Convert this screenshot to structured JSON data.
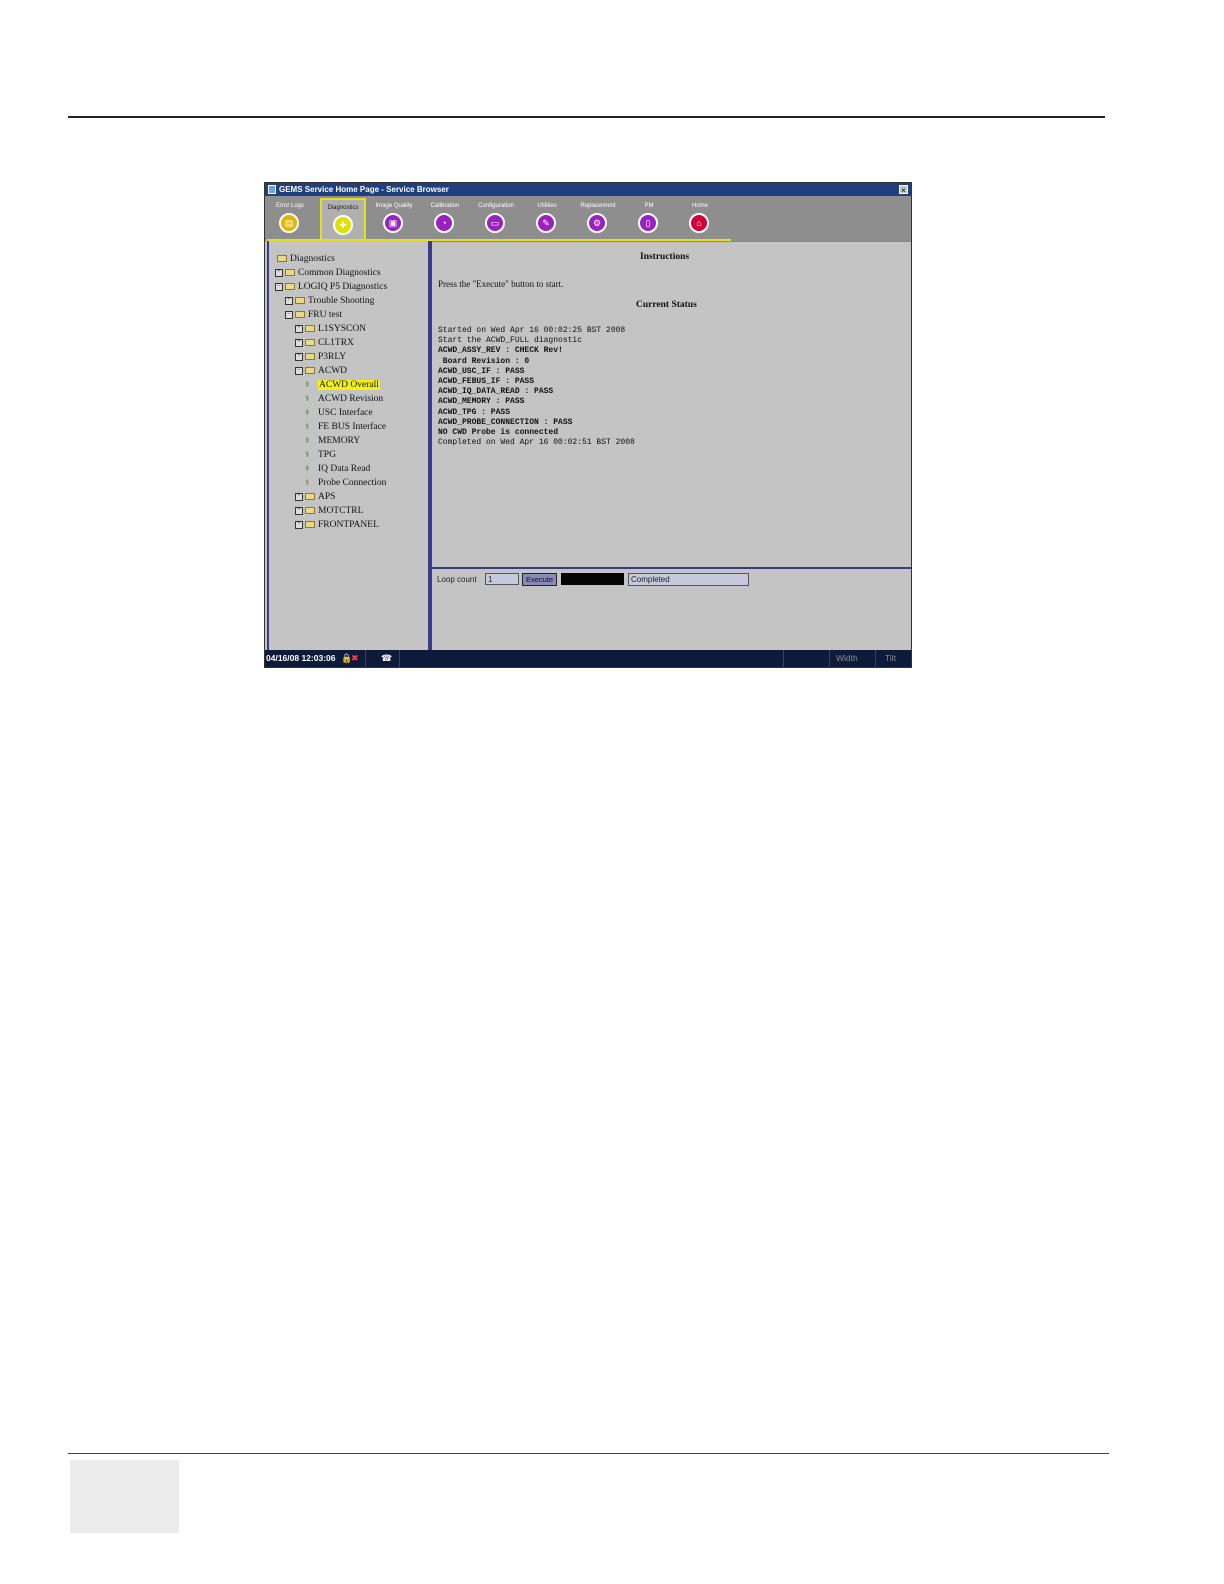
{
  "window": {
    "title": "GEMS Service Home Page - Service Browser",
    "close_glyph": "×"
  },
  "tabs": [
    {
      "label": "Error Logs",
      "icon": "list-icon",
      "color": "#e6b400",
      "glyph": "▤"
    },
    {
      "label": "Diagnostics",
      "icon": "stethoscope-icon",
      "color": "#e2e000",
      "glyph": "✚"
    },
    {
      "label": "Image Quality",
      "icon": "image-icon",
      "color": "#9a20c0",
      "glyph": "▣"
    },
    {
      "label": "Calibration",
      "icon": "gauge-icon",
      "color": "#9a20c0",
      "glyph": "◔"
    },
    {
      "label": "Configuration",
      "icon": "config-icon",
      "color": "#9a20c0",
      "glyph": "▭"
    },
    {
      "label": "Utilities",
      "icon": "tools-icon",
      "color": "#9a20c0",
      "glyph": "✎"
    },
    {
      "label": "Replacement",
      "icon": "wrench-icon",
      "color": "#9a20c0",
      "glyph": "⚙"
    },
    {
      "label": "PM",
      "icon": "clipboard-icon",
      "color": "#9a20c0",
      "glyph": "▯"
    },
    {
      "label": "Home",
      "icon": "home-icon",
      "color": "#d0003a",
      "glyph": "⌂"
    }
  ],
  "tree": [
    {
      "label": "Diagnostics",
      "indent": 0,
      "type": "folder-open",
      "toggle": ""
    },
    {
      "label": "Common Diagnostics",
      "indent": 0,
      "type": "folder",
      "toggle": "+"
    },
    {
      "label": "LOGIQ P5 Diagnostics",
      "indent": 0,
      "type": "folder-open",
      "toggle": "−"
    },
    {
      "label": "Trouble Shooting",
      "indent": 1,
      "type": "folder",
      "toggle": "+"
    },
    {
      "label": "FRU test",
      "indent": 1,
      "type": "folder-open",
      "toggle": "−"
    },
    {
      "label": "L1SYSCON",
      "indent": 2,
      "type": "folder",
      "toggle": "+"
    },
    {
      "label": "CL1TRX",
      "indent": 2,
      "type": "folder",
      "toggle": "+"
    },
    {
      "label": "P3RLY",
      "indent": 2,
      "type": "folder",
      "toggle": "+"
    },
    {
      "label": "ACWD",
      "indent": 2,
      "type": "folder-open",
      "toggle": "−"
    },
    {
      "label": "ACWD Overall",
      "indent": 3,
      "type": "leaf",
      "toggle": "",
      "selected": true
    },
    {
      "label": "ACWD Revision",
      "indent": 3,
      "type": "leaf",
      "toggle": ""
    },
    {
      "label": "USC Interface",
      "indent": 3,
      "type": "leaf",
      "toggle": ""
    },
    {
      "label": "FE BUS Interface",
      "indent": 3,
      "type": "leaf",
      "toggle": ""
    },
    {
      "label": "MEMORY",
      "indent": 3,
      "type": "leaf",
      "toggle": ""
    },
    {
      "label": "TPG",
      "indent": 3,
      "type": "leaf",
      "toggle": ""
    },
    {
      "label": "IQ Data Read",
      "indent": 3,
      "type": "leaf",
      "toggle": ""
    },
    {
      "label": "Probe Connection",
      "indent": 3,
      "type": "leaf",
      "toggle": ""
    },
    {
      "label": "APS",
      "indent": 2,
      "type": "folder",
      "toggle": "+"
    },
    {
      "label": "MOTCTRL",
      "indent": 2,
      "type": "folder",
      "toggle": "+"
    },
    {
      "label": "FRONTPANEL",
      "indent": 2,
      "type": "folder",
      "toggle": "+"
    }
  ],
  "instructions": {
    "heading": "Instructions",
    "text": "Press the \"Execute\" button to start."
  },
  "current_status": {
    "heading": "Current Status",
    "lines": [
      "Started on Wed Apr 16 00:02:25 BST 2008",
      "Start the ACWD_FULL diagnostic",
      "ACWD_ASSY_REV : CHECK Rev!",
      " Board Revision : 0",
      "ACWD_USC_IF : PASS",
      "ACWD_FEBUS_IF : PASS",
      "ACWD_IQ_DATA_READ : PASS",
      "ACWD_MEMORY : PASS",
      "ACWD_TPG : PASS",
      "ACWD_PROBE_CONNECTION : PASS",
      "NO CWD Probe is connected",
      "Completed on Wed Apr 16 00:02:51 BST 2008"
    ]
  },
  "controls": {
    "loop_count_label": "Loop count",
    "loop_count_value": "1",
    "execute_label": "Execute",
    "status_value": "Completed"
  },
  "statusbar": {
    "datetime": "04/16/08 12:03:06",
    "width_label": "Width",
    "tilt_label": "Tilt"
  }
}
